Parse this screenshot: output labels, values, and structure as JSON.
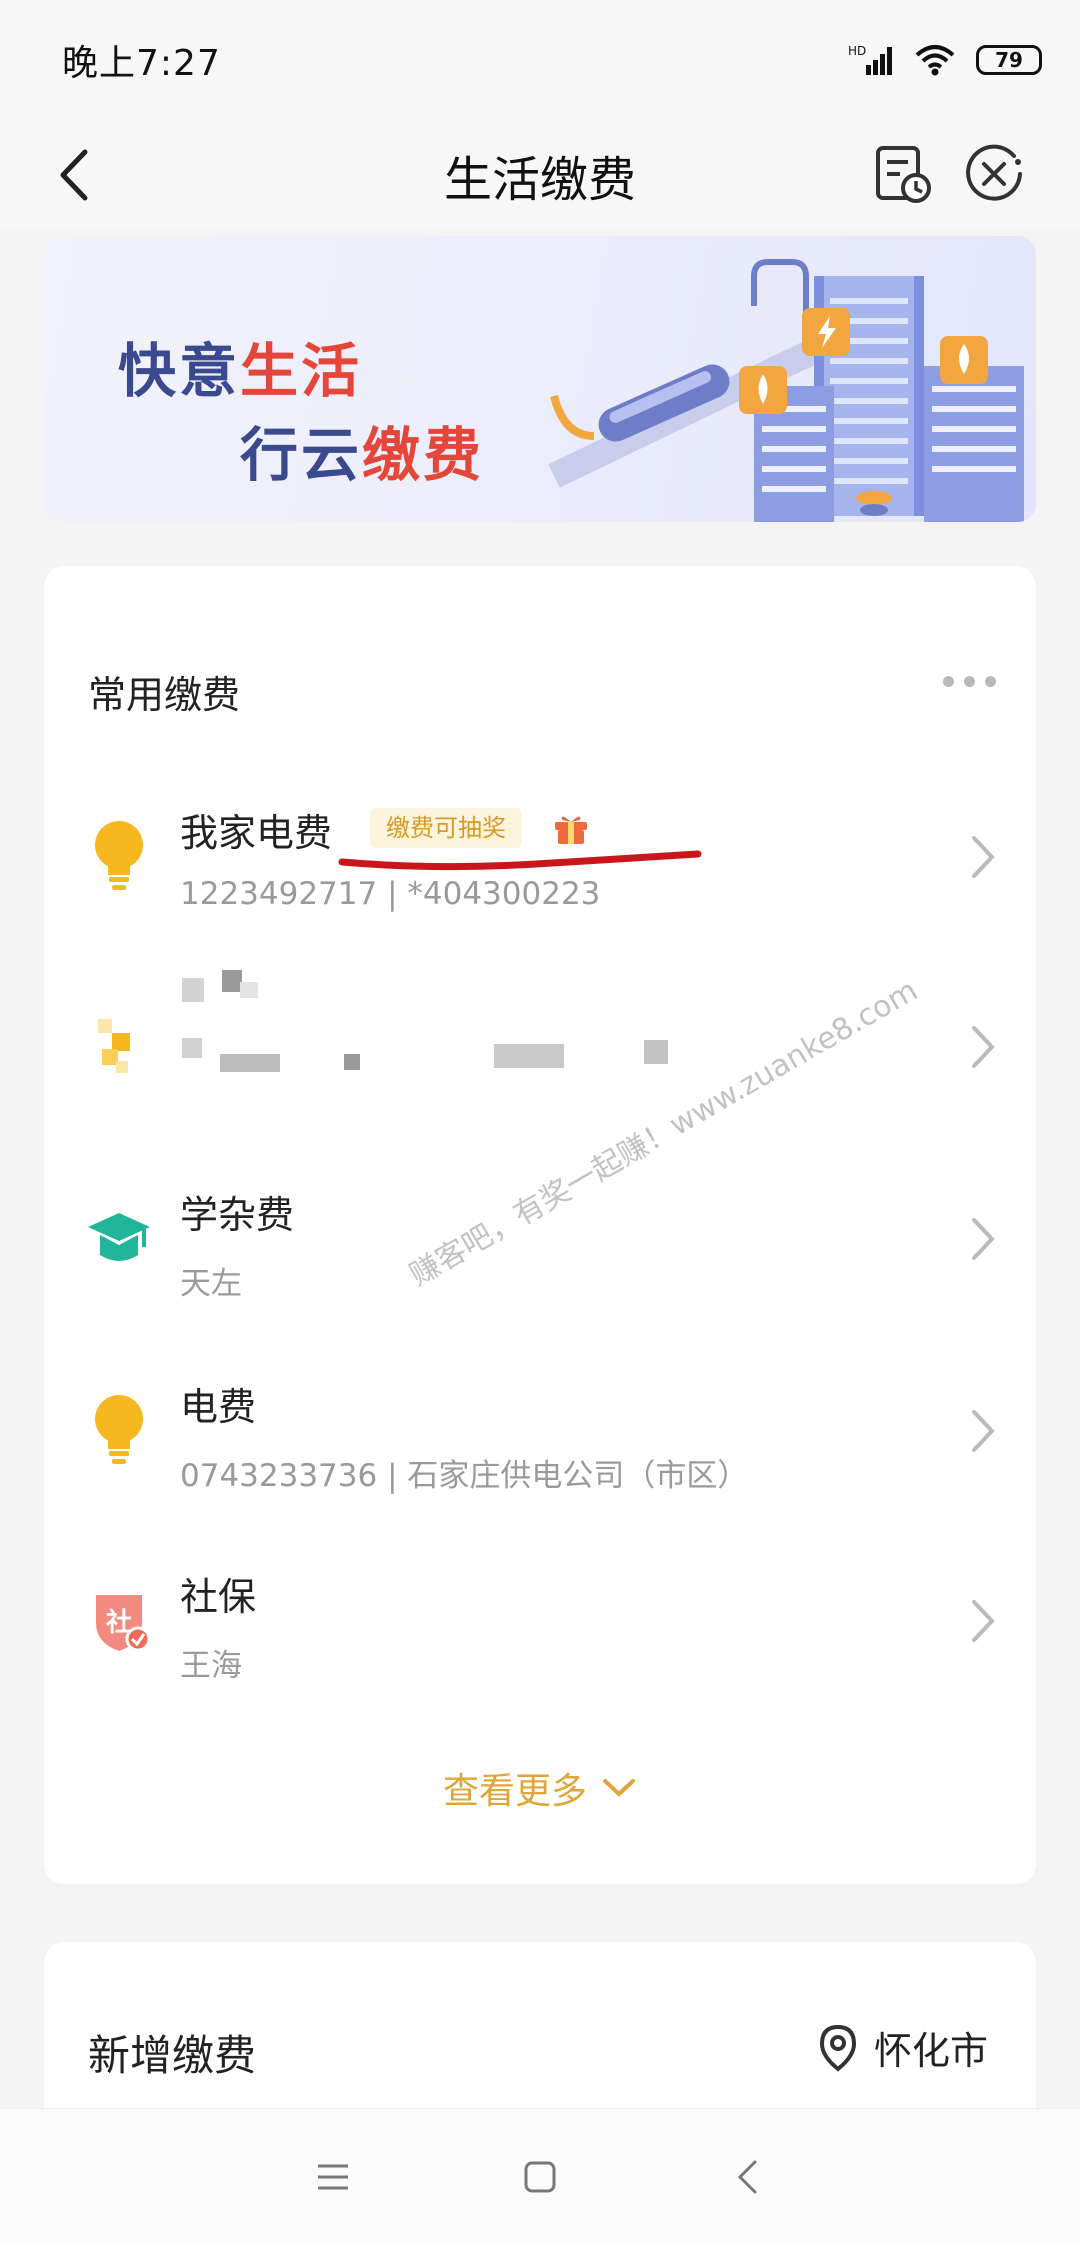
{
  "status_bar": {
    "time": "晚上7:27",
    "network_label": "HD",
    "battery": "79"
  },
  "header": {
    "title": "生活缴费",
    "icons": [
      "back-icon",
      "bill-history-icon",
      "close-miniprogram-icon"
    ]
  },
  "banner": {
    "line1_a": "快意",
    "line1_b": "生活",
    "line2_a": "行云",
    "line2_b": "缴费"
  },
  "common_payments": {
    "title": "常用缴费",
    "items": [
      {
        "name": "我家电费",
        "sub": "1223492717 | *404300223",
        "promo": "缴费可抽奖",
        "icon": "lightbulb-icon"
      },
      {
        "name": "",
        "sub": "",
        "icon": "utility-icon"
      },
      {
        "name": "学杂费",
        "sub": "天左",
        "icon": "graduation-cap-icon"
      },
      {
        "name": "电费",
        "sub": "0743233736 | 石家庄供电公司（市区）",
        "icon": "lightbulb-icon"
      },
      {
        "name": "社保",
        "sub": "王海",
        "icon": "social-security-icon"
      }
    ],
    "see_more": "查看更多"
  },
  "new_payment": {
    "title": "新增缴费",
    "city": "怀化市"
  },
  "watermark": "赚客吧，有奖一起赚！www.zuanke8.com",
  "colors": {
    "accent_gold": "#e0a53a",
    "bulb_yellow": "#f6b81e",
    "teal": "#21b59a",
    "social_red": "#ee6b5c"
  }
}
